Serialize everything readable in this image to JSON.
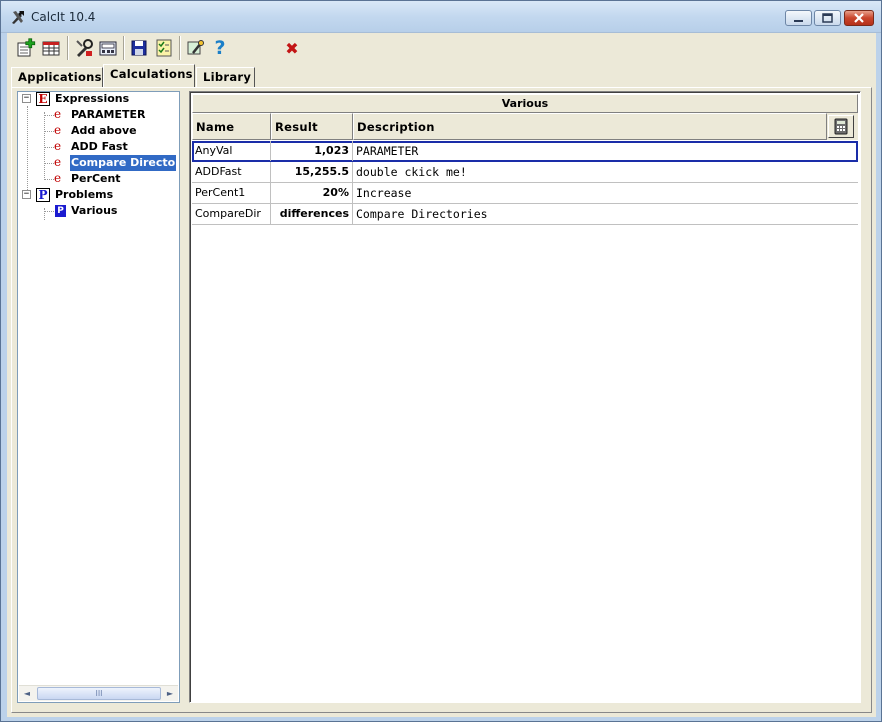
{
  "window": {
    "title": "CalcIt 10.4"
  },
  "toolbar": {
    "buttons": [
      {
        "name": "new-calculation-button",
        "icon": "plus-sheet-icon"
      },
      {
        "name": "table-button",
        "icon": "table-icon"
      },
      {
        "name": "tools-button",
        "icon": "tools-icon"
      },
      {
        "name": "calculator-display-button",
        "icon": "calculator-display-icon"
      },
      {
        "name": "save-button",
        "icon": "floppy-disk-icon"
      },
      {
        "name": "checklist-button",
        "icon": "checklist-icon"
      },
      {
        "name": "options-button",
        "icon": "wrench-icon"
      },
      {
        "name": "help-button",
        "icon": "question-icon",
        "glyph": "?"
      },
      {
        "name": "delete-button",
        "icon": "red-x-icon",
        "glyph": "✖"
      }
    ]
  },
  "tabs": [
    {
      "label": "Applications",
      "active": false
    },
    {
      "label": "Calculations",
      "active": true
    },
    {
      "label": "Library",
      "active": false
    }
  ],
  "tree": {
    "groups": [
      {
        "badge": "E",
        "label": "Expressions",
        "expander": "−",
        "items": [
          {
            "badge": "e",
            "label": "PARAMETER"
          },
          {
            "badge": "e",
            "label": "Add above"
          },
          {
            "badge": "e",
            "label": "ADD Fast"
          },
          {
            "badge": "e",
            "label": "Compare Directo",
            "selected": true
          },
          {
            "badge": "e",
            "label": "PerCent"
          }
        ]
      },
      {
        "badge": "P",
        "label": "Problems",
        "expander": "−",
        "items": [
          {
            "badge": "P",
            "label": "Various"
          }
        ]
      }
    ],
    "scroll": {
      "left": "◄",
      "right": "►",
      "grip": "III"
    }
  },
  "grid": {
    "caption": "Various",
    "columns": [
      "Name",
      "Result",
      "Description"
    ],
    "rows": [
      {
        "name": "AnyVal",
        "result": "1,023",
        "description": "PARAMETER"
      },
      {
        "name": "ADDFast",
        "result": "15,255.5",
        "description": "double ckick me!"
      },
      {
        "name": "PerCent1",
        "result": "20%",
        "description": "Increase"
      },
      {
        "name": "CompareDir",
        "result": "differences",
        "description": "Compare Directories"
      }
    ]
  },
  "colors": {
    "selection": "#316ac5",
    "expression_badge": "#c00000",
    "problem_badge": "#1b1bd0",
    "focus_outline": "#1a2da8"
  }
}
